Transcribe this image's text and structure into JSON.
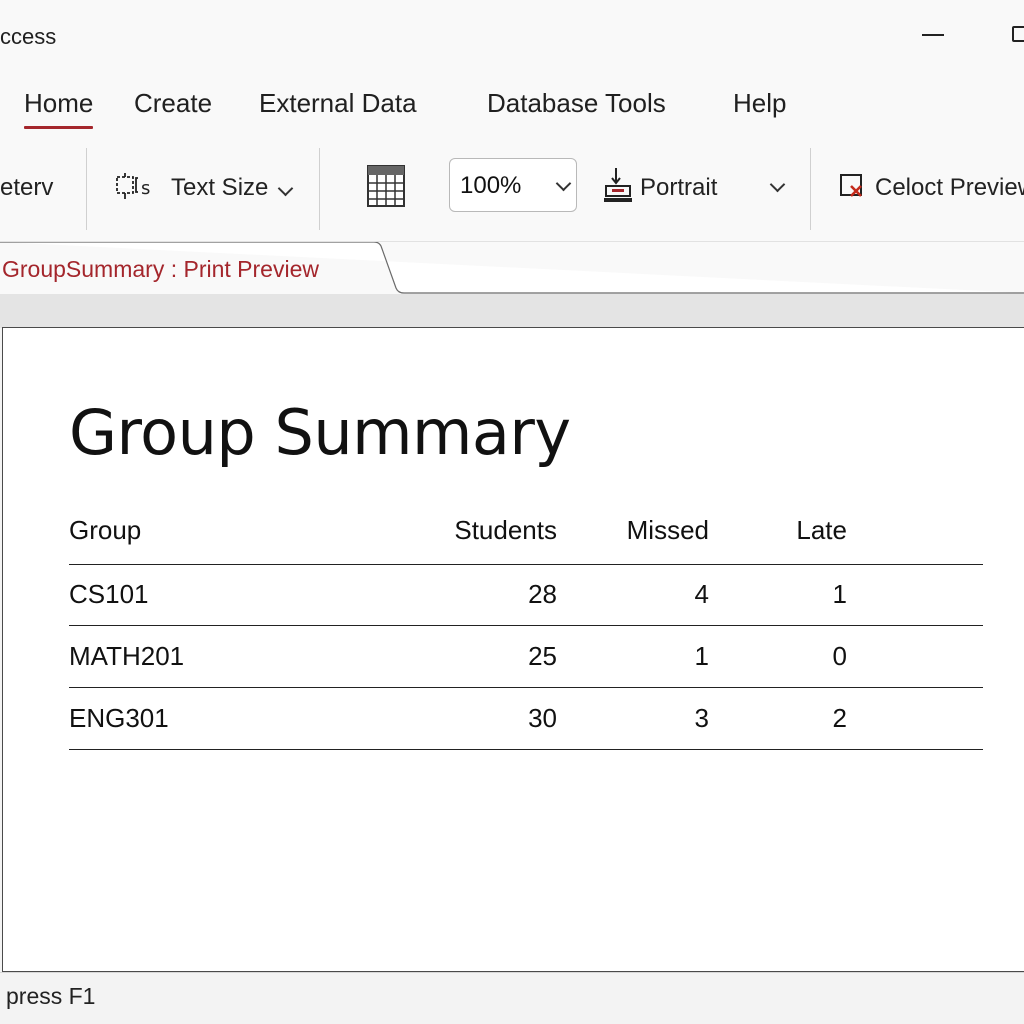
{
  "window": {
    "title": "ccess"
  },
  "ribbon_tabs": [
    {
      "label": "Home",
      "active": true
    },
    {
      "label": "Create",
      "active": false
    },
    {
      "label": "External Data",
      "active": false
    },
    {
      "label": "Database Tools",
      "active": false
    },
    {
      "label": "Help",
      "active": false
    }
  ],
  "ribbon": {
    "left_partial_label": "eterv",
    "text_size_label": "Text Size",
    "zoom_value": "100%",
    "orientation_label": "Portrait",
    "close_preview_label": "Celoct Preview"
  },
  "document_tab": {
    "label": "GroupSummary : Print  Preview"
  },
  "report": {
    "title": "Group Summary",
    "columns": [
      "Group",
      "Students",
      "Missed",
      "Late"
    ],
    "rows": [
      [
        "CS101",
        "28",
        "4",
        "1"
      ],
      [
        "MATH201",
        "25",
        "1",
        "0"
      ],
      [
        "ENG301",
        "30",
        "3",
        "2"
      ]
    ]
  },
  "status_bar": {
    "text": "press F1"
  },
  "colors": {
    "accent": "#a4262c",
    "page_background": "#ffffff",
    "chrome_background": "#f9f9f9"
  }
}
